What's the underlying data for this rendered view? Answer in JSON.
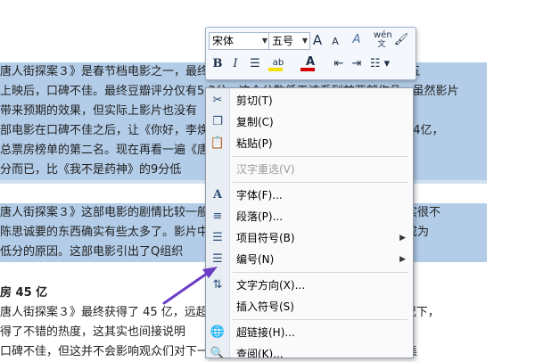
{
  "document": {
    "lines": [
      "唐人街探案３》是春节档电影之一，最终票房达到了45亿，并在总票房榜单的第五",
      "上映后，口碑不佳。最终豆瓣评分仅有5.3分，这个分数低于该系列前两部作品。虽然影片",
      "带来预期的效果，但实际上影片也没有",
      "部电影在口碑不佳之后，让《你好，李焕英》在这个假期成为票房冠军，达到了54亿，",
      "总票房榜单的第二名。现在再看一遍《唐探3》的评分就显得相当尴尬了，豆瓣也",
      "分而已，比《我不是药神》的9分低",
      "唐人街探案３》这部电影的剧情比较一般，有很多网友表示这部电影的剧情的确实很不",
      "陈思诚要的东西确实有些太多了。影片中的某些笑点和剧情设计的结构，并不该成为",
      "低分的原因。这部电影引出了Q组织",
      "房 45 亿",
      "唐人街探案３》最终获得了 45 亿，远超了其他同档期电影。这种大家预期的情况下，",
      "得了不错的热度，这其实也间接说明",
      "口碑不佳，但这并不会影响观众们对下一部电影的期待，如果唐探系列两部的续集"
    ]
  },
  "mini_toolbar": {
    "font_name": "宋体",
    "font_size": "五号",
    "grow_font_label": "A",
    "shrink_font_label": "A",
    "bold_label": "B",
    "italic_label": "I",
    "font_color_label": "A",
    "phonetic_label": "wén",
    "colors": {
      "highlight": "#f2e200",
      "font_color": "#d40000"
    }
  },
  "context_menu": {
    "items": [
      {
        "label": "剪切(T)",
        "icon": "scissors-icon",
        "enabled": true
      },
      {
        "label": "复制(C)",
        "icon": "copy-icon",
        "enabled": true
      },
      {
        "label": "粘贴(P)",
        "icon": "paste-icon",
        "enabled": true
      },
      {
        "label": "汉字重选(V)",
        "icon": "",
        "enabled": false
      },
      {
        "label": "字体(F)...",
        "icon": "font-icon",
        "enabled": true
      },
      {
        "label": "段落(P)...",
        "icon": "paragraph-icon",
        "enabled": true
      },
      {
        "label": "项目符号(B)",
        "icon": "bullets-icon",
        "enabled": true,
        "submenu": true
      },
      {
        "label": "编号(N)",
        "icon": "numbering-icon",
        "enabled": true,
        "submenu": true
      },
      {
        "label": "文字方向(X)...",
        "icon": "text-direction-icon",
        "enabled": true
      },
      {
        "label": "插入符号(S)",
        "icon": "",
        "enabled": true
      },
      {
        "label": "超链接(H)...",
        "icon": "hyperlink-icon",
        "enabled": true
      },
      {
        "label": "查阅(K)...",
        "icon": "lookup-icon",
        "enabled": true
      }
    ]
  },
  "annotation": {
    "arrow_color": "#6a3ec2"
  }
}
